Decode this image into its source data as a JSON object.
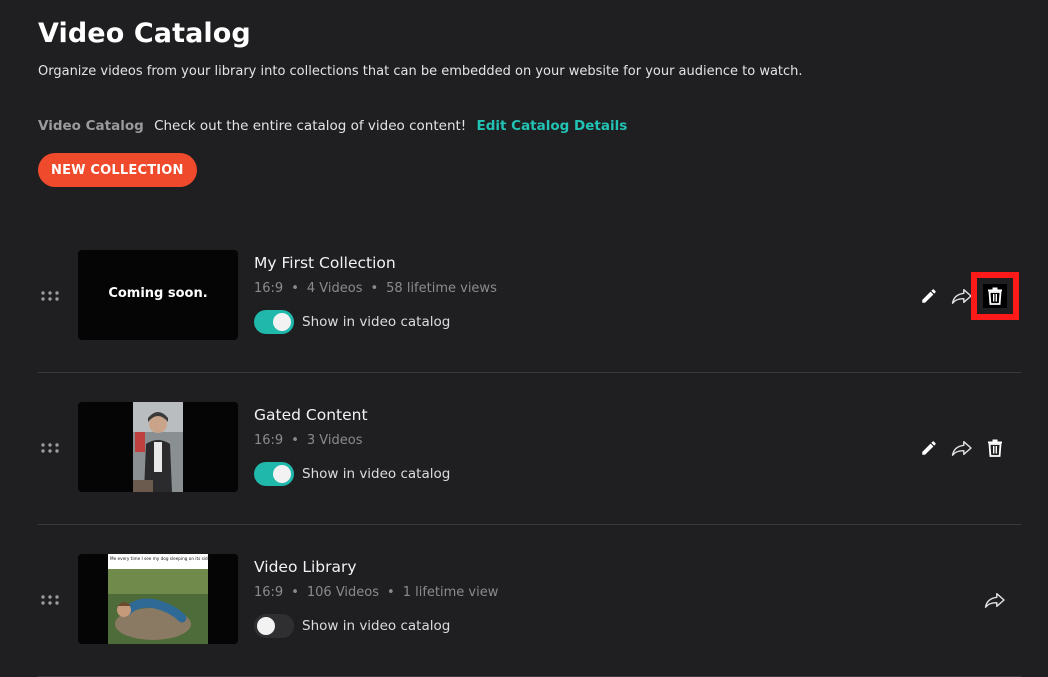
{
  "page": {
    "title": "Video Catalog",
    "subtitle": "Organize videos from your library into collections that can be embedded on your website for your audience to watch."
  },
  "catalog": {
    "label": "Video Catalog",
    "description": "Check out the entire catalog of video content!",
    "edit_link": "Edit Catalog Details"
  },
  "toolbar": {
    "new_collection": "NEW COLLECTION"
  },
  "collections": [
    {
      "name": "My First Collection",
      "thumb_text": "Coming soon.",
      "aspect": "16:9",
      "videos": "4 Videos",
      "views": "58 lifetime views",
      "show_label": "Show in video catalog",
      "show_in_catalog": true,
      "actions": [
        "pencil-icon",
        "share-icon",
        "trash-icon"
      ]
    },
    {
      "name": "Gated Content",
      "aspect": "16:9",
      "videos": "3 Videos",
      "show_label": "Show in video catalog",
      "show_in_catalog": true,
      "actions": [
        "pencil-icon",
        "share-icon",
        "trash-icon"
      ]
    },
    {
      "name": "Video Library",
      "thumb_caption": "Me every time I see my dog sleeping on its side.",
      "aspect": "16:9",
      "videos": "106 Videos",
      "views": "1 lifetime view",
      "show_label": "Show in video catalog",
      "show_in_catalog": false,
      "actions": [
        "share-icon"
      ]
    }
  ],
  "colors": {
    "background": "#1f1f21",
    "accent_teal": "#21c3b4",
    "button_orange": "#f04a2c",
    "highlight_red": "#ff1a1a"
  }
}
